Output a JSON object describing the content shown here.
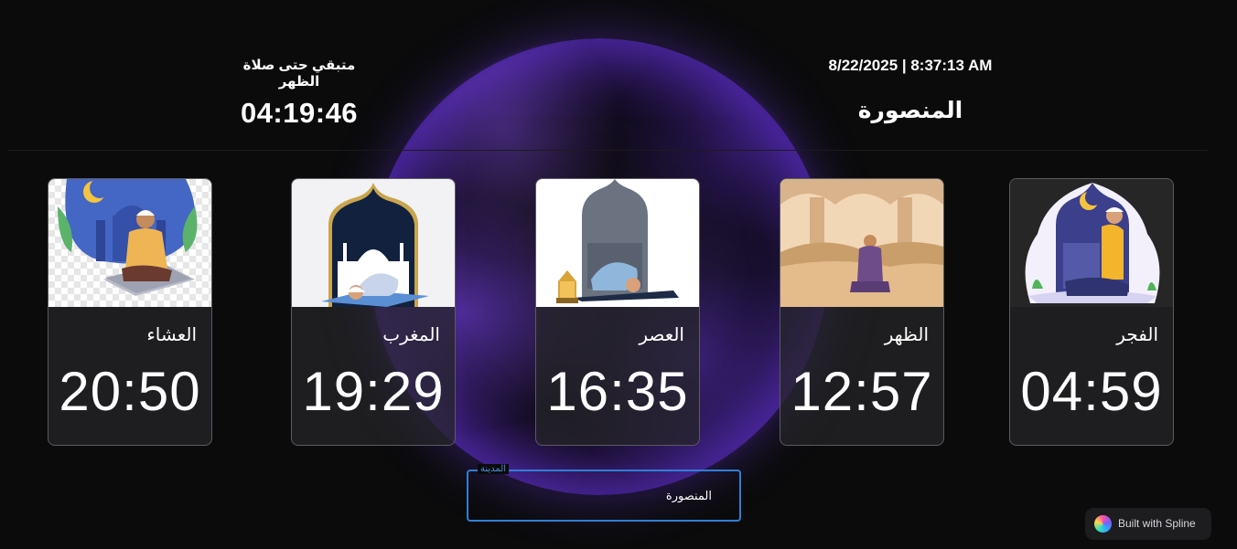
{
  "header": {
    "countdown_label": "متبقي حتى صلاة الظهر",
    "countdown_value": "04:19:46",
    "datetime": "8/22/2025 | 8:37:13 AM",
    "city": "المنصورة"
  },
  "prayers": [
    {
      "name": "العشاء",
      "time": "20:50",
      "illustration": "man-praying-on-mat-night"
    },
    {
      "name": "المغرب",
      "time": "19:29",
      "illustration": "man-prostrating-mosque-arch"
    },
    {
      "name": "العصر",
      "time": "16:35",
      "illustration": "man-prostrating-lantern"
    },
    {
      "name": "الظهر",
      "time": "12:57",
      "illustration": "man-praying-desert-arches"
    },
    {
      "name": "الفجر",
      "time": "04:59",
      "illustration": "man-praying-crescent-moon"
    }
  ],
  "city_select": {
    "label": "المدينة",
    "value": "المنصورة"
  },
  "badge": {
    "label": "Built with Spline",
    "icon": "spline-logo-icon"
  },
  "colors": {
    "background": "#0b0b0c",
    "accent_border": "#2f7fd6",
    "globe_glow": "#7b3cff"
  }
}
